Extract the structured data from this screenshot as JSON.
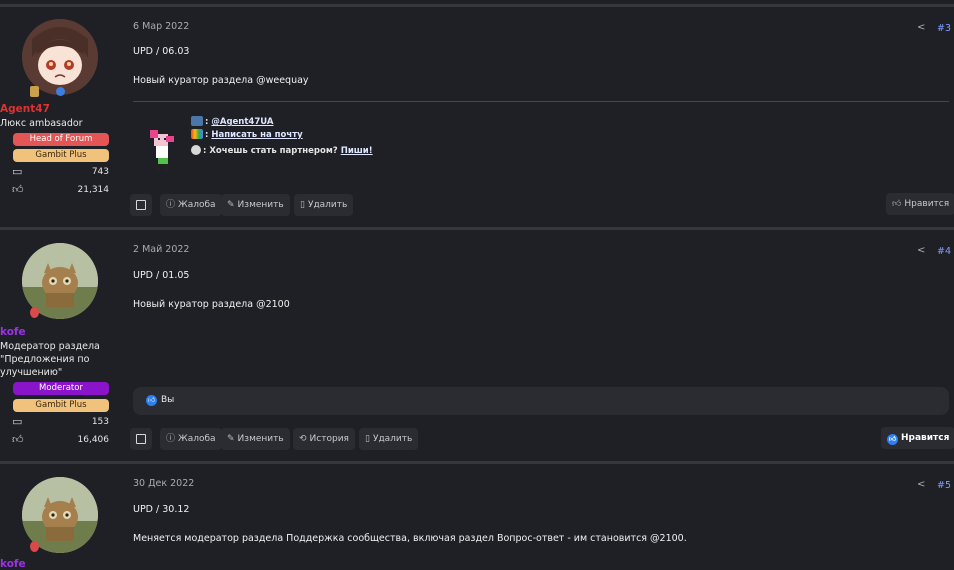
{
  "posts": [
    {
      "date": "6 Мар 2022",
      "number": "#3",
      "user": {
        "name": "Agent47",
        "name_color": "#e03131",
        "title": "Люкс ambasador",
        "banners": [
          {
            "label": "Head of Forum",
            "bg": "#e45555",
            "fg": "#ffffff"
          },
          {
            "label": "Gambit Plus",
            "bg": "#f0c27b",
            "fg": "#3a2a10"
          }
        ],
        "messages": "743",
        "likes": "21,314"
      },
      "lines": [
        "UPD / 06.03",
        "Новый куратор раздела @weequay"
      ],
      "signature": {
        "vk_prefix": ": ",
        "vk_link": "@Agent47UA",
        "mail_prefix": ": ",
        "mail_link": "Написать на почту",
        "partner_prefix": ": Хочешь стать партнером? ",
        "partner_link": "Пиши!"
      },
      "actions": {
        "report": "Жалоба",
        "edit": "Изменить",
        "delete": "Удалить",
        "like": "Нравится"
      }
    },
    {
      "date": "2 Май 2022",
      "number": "#4",
      "user": {
        "name": "kofe",
        "name_color": "#9b32e8",
        "title": "Модератор раздела \"Предложения по улучшению\"",
        "banners": [
          {
            "label": "Moderator",
            "bg": "#8a14c9",
            "fg": "#ffffff"
          },
          {
            "label": "Gambit Plus",
            "bg": "#f0c27b",
            "fg": "#3a2a10"
          }
        ],
        "messages": "153",
        "likes": "16,406"
      },
      "lines": [
        "UPD / 01.05",
        "Новый куратор раздела @2100"
      ],
      "reaction": "Вы",
      "actions": {
        "report": "Жалоба",
        "edit": "Изменить",
        "history": "История",
        "delete": "Удалить",
        "like": "Нравится"
      }
    },
    {
      "date": "30 Дек 2022",
      "number": "#5",
      "user": {
        "name": "kofe",
        "name_color": "#9b32e8"
      },
      "lines": [
        "UPD / 30.12",
        "Меняется модератор раздела Поддержка сообщества, включая раздел Вопрос-ответ - им становится @2100."
      ]
    }
  ],
  "icons": {
    "share": "share-icon",
    "messages": "messages-icon",
    "likes": "thumbs-up-icon",
    "report": "report-icon",
    "edit": "pencil-icon",
    "history": "history-icon",
    "delete": "trash-icon"
  },
  "colors": {
    "background": "#1f2025",
    "accent": "#7e9dff",
    "like": "#2f7ff0"
  },
  "signature_icons": {
    "vk": "ВК",
    "mail": "М"
  }
}
